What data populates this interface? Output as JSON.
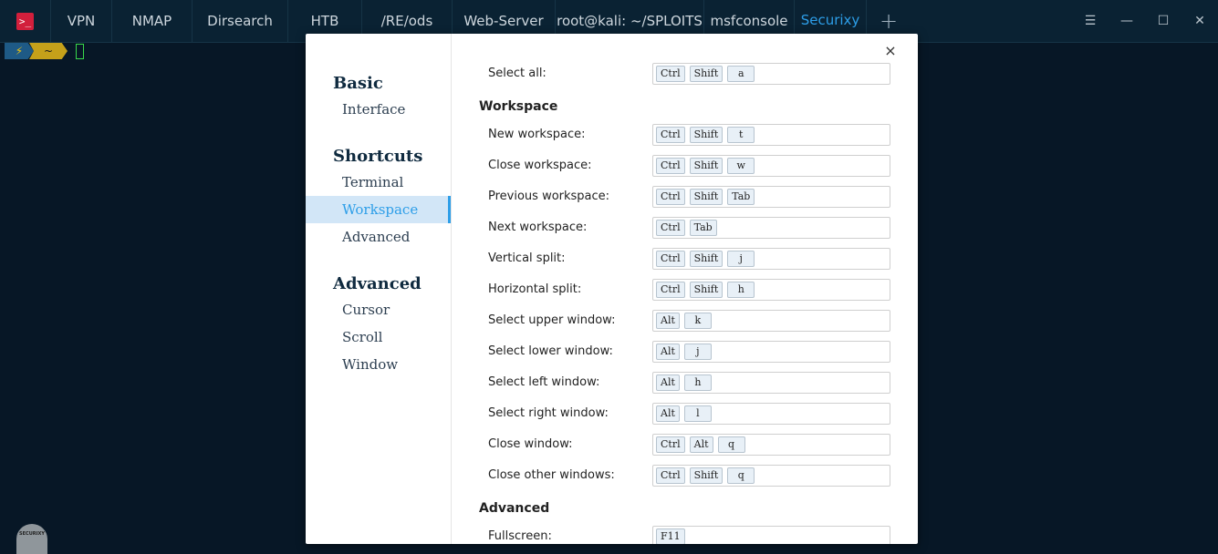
{
  "tabs": [
    {
      "label": "VPN",
      "width": 66
    },
    {
      "label": "NMAP",
      "width": 87
    },
    {
      "label": "Dirsearch",
      "width": 104
    },
    {
      "label": "HTB",
      "width": 80
    },
    {
      "label": "/RE/ods",
      "width": 98
    },
    {
      "label": "Web-Server",
      "width": 112
    },
    {
      "label": "root@kali: ~/SPLOITS",
      "width": 162
    },
    {
      "label": "msfconsole",
      "width": 98
    },
    {
      "label": "Securixy",
      "width": 78,
      "active": true
    }
  ],
  "window_controls": {
    "menu": "☰",
    "minimize": "—",
    "maximize": "☐",
    "close": "✕"
  },
  "prompt": {
    "icon": "⚡",
    "dir": "~"
  },
  "mascot_text": "SECURIXY",
  "modal": {
    "close": "×",
    "sidebar": {
      "sections": [
        {
          "title": "Basic",
          "items": [
            "Interface"
          ]
        },
        {
          "title": "Shortcuts",
          "items": [
            "Terminal",
            "Workspace",
            "Advanced"
          ]
        },
        {
          "title": "Advanced",
          "items": [
            "Cursor",
            "Scroll",
            "Window"
          ]
        }
      ],
      "active": "Workspace"
    },
    "content": {
      "top_row": {
        "label": "Select all:",
        "keys": [
          "Ctrl",
          "Shift",
          "a"
        ]
      },
      "workspace_title": "Workspace",
      "workspace_rows": [
        {
          "label": "New workspace:",
          "keys": [
            "Ctrl",
            "Shift",
            "t"
          ]
        },
        {
          "label": "Close workspace:",
          "keys": [
            "Ctrl",
            "Shift",
            "w"
          ]
        },
        {
          "label": "Previous workspace:",
          "keys": [
            "Ctrl",
            "Shift",
            "Tab"
          ]
        },
        {
          "label": "Next workspace:",
          "keys": [
            "Ctrl",
            "Tab"
          ]
        },
        {
          "label": "Vertical split:",
          "keys": [
            "Ctrl",
            "Shift",
            "j"
          ]
        },
        {
          "label": "Horizontal split:",
          "keys": [
            "Ctrl",
            "Shift",
            "h"
          ]
        },
        {
          "label": "Select upper window:",
          "keys": [
            "Alt",
            "k"
          ]
        },
        {
          "label": "Select lower window:",
          "keys": [
            "Alt",
            "j"
          ]
        },
        {
          "label": "Select left window:",
          "keys": [
            "Alt",
            "h"
          ]
        },
        {
          "label": "Select right window:",
          "keys": [
            "Alt",
            "l"
          ]
        },
        {
          "label": "Close window:",
          "keys": [
            "Ctrl",
            "Alt",
            "q"
          ]
        },
        {
          "label": "Close other windows:",
          "keys": [
            "Ctrl",
            "Shift",
            "q"
          ]
        }
      ],
      "advanced_title": "Advanced",
      "advanced_rows": [
        {
          "label": "Fullscreen:",
          "keys": [
            "F11"
          ]
        }
      ]
    }
  }
}
